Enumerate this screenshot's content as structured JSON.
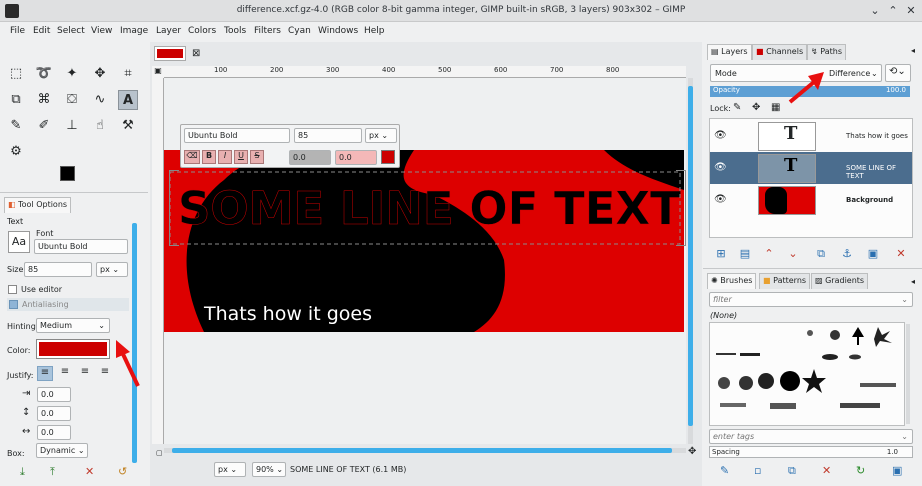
{
  "window": {
    "title": "difference.xcf.gz-4.0 (RGB color 8-bit gamma integer, GIMP built-in sRGB, 3 layers) 903x302 – GIMP"
  },
  "menu": [
    "File",
    "Edit",
    "Select",
    "View",
    "Image",
    "Layer",
    "Colors",
    "Tools",
    "Filters",
    "Cyan",
    "Windows",
    "Help"
  ],
  "tool_options": {
    "tab_label": "Tool Options",
    "section": "Text",
    "font_label": "Font",
    "font_value": "Ubuntu Bold",
    "size_label": "Size:",
    "size_value": "85",
    "size_unit": "px",
    "use_editor": "Use editor",
    "antialiasing": "Antialiasing",
    "hinting_label": "Hinting:",
    "hinting_value": "Medium",
    "color_label": "Color:",
    "justify_label": "Justify:",
    "indent": "0.0",
    "line_spacing": "0.0",
    "letter_spacing": "0.0",
    "box_label": "Box:",
    "box_value": "Dynamic",
    "text_color": "#cc0000"
  },
  "canvas": {
    "ruler_marks": [
      "100",
      "200",
      "300",
      "400",
      "500",
      "600",
      "700",
      "800"
    ],
    "text_toolbar": {
      "font": "Ubuntu Bold",
      "size": "85",
      "unit": "px",
      "baseline": "0.0",
      "kerning": "0.0",
      "style_buttons": [
        "B",
        "I",
        "U",
        "S"
      ]
    },
    "headline": "SOME LINE OF TEXT",
    "subtext": "Thats how it goes"
  },
  "statusbar": {
    "unit": "px",
    "zoom": "90%",
    "layer_info": "SOME LINE OF TEXT (6.1 MB)"
  },
  "layers": {
    "tabs": [
      "Layers",
      "Channels",
      "Paths"
    ],
    "mode_label": "Mode",
    "mode_value": "Difference",
    "opacity_label": "Opacity",
    "opacity_value": "100.0",
    "lock_label": "Lock:",
    "items": [
      {
        "name": "Thats how it goes"
      },
      {
        "name": "SOME LINE OF TEXT"
      },
      {
        "name": "Background"
      }
    ]
  },
  "brushes": {
    "tabs": [
      "Brushes",
      "Patterns",
      "Gradients"
    ],
    "filter_placeholder": "filter",
    "category": "(None)",
    "tags_placeholder": "enter tags",
    "spacing_label": "Spacing",
    "spacing_value": "1.0"
  }
}
